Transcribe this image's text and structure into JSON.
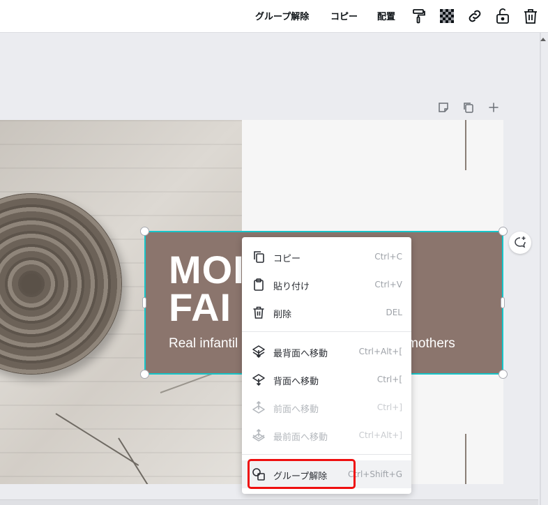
{
  "toolbar": {
    "ungroup_label": "グループ解除",
    "copy_label": "コピー",
    "arrange_label": "配置",
    "icons": [
      "paint-roller-icon",
      "transparency-icon",
      "link-icon",
      "unlock-icon",
      "trash-icon"
    ]
  },
  "page_tools": {
    "icons": [
      "note-icon",
      "duplicate-page-icon",
      "add-page-icon"
    ]
  },
  "design": {
    "title_line1": "MOI",
    "title_line2": "FAI",
    "subtitle": "Real infantil                                              mothers",
    "banner_color": "#8b756d",
    "selection_color": "#16c5c9"
  },
  "context_menu": {
    "items": [
      {
        "label": "コピー",
        "shortcut": "Ctrl+C",
        "icon": "copy-icon",
        "enabled": true
      },
      {
        "label": "貼り付け",
        "shortcut": "Ctrl+V",
        "icon": "paste-icon",
        "enabled": true
      },
      {
        "label": "削除",
        "shortcut": "DEL",
        "icon": "trash-icon",
        "enabled": true
      },
      {
        "label": "最背面へ移動",
        "shortcut": "Ctrl+Alt+[",
        "icon": "send-to-back-icon",
        "enabled": true
      },
      {
        "label": "背面へ移動",
        "shortcut": "Ctrl+[",
        "icon": "send-backward-icon",
        "enabled": true
      },
      {
        "label": "前面へ移動",
        "shortcut": "Ctrl+]",
        "icon": "bring-forward-icon",
        "enabled": false
      },
      {
        "label": "最前面へ移動",
        "shortcut": "Ctrl+Alt+]",
        "icon": "bring-to-front-icon",
        "enabled": false
      },
      {
        "label": "グループ解除",
        "shortcut": "Ctrl+Shift+G",
        "icon": "ungroup-icon",
        "enabled": true,
        "highlighted": true
      }
    ]
  },
  "colors": {
    "highlight_border": "#ef0f0f",
    "accent_teal": "#16c5c9"
  }
}
